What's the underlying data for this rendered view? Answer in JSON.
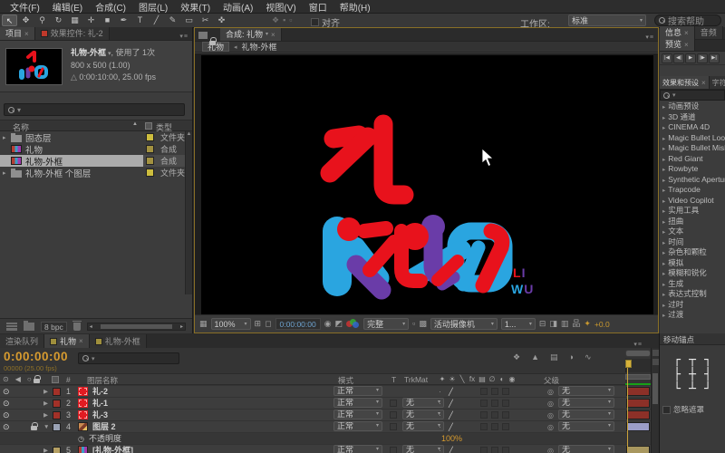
{
  "menu_bar": {
    "items": [
      "文件(F)",
      "编辑(E)",
      "合成(C)",
      "图层(L)",
      "效果(T)",
      "动画(A)",
      "视图(V)",
      "窗口",
      "帮助(H)"
    ]
  },
  "toolbar": {
    "tools": [
      {
        "name": "selection-tool",
        "glyph": "↖",
        "active": true
      },
      {
        "name": "hand-tool",
        "glyph": "✥"
      },
      {
        "name": "zoom-tool",
        "glyph": "⚲"
      },
      {
        "name": "rotation-tool",
        "glyph": "↻"
      },
      {
        "name": "camera-tool",
        "glyph": "▦"
      },
      {
        "name": "pan-behind-tool",
        "glyph": "✛"
      },
      {
        "name": "shape-tool",
        "glyph": "■"
      },
      {
        "name": "pen-tool",
        "glyph": "✒"
      },
      {
        "name": "text-tool",
        "glyph": "T"
      },
      {
        "name": "brush-tool",
        "glyph": "╱"
      },
      {
        "name": "clone-stamp-tool",
        "glyph": "✎"
      },
      {
        "name": "eraser-tool",
        "glyph": "▭"
      },
      {
        "name": "roto-brush-tool",
        "glyph": "✂"
      },
      {
        "name": "puppet-pin-tool",
        "glyph": "✜"
      }
    ],
    "extra_icons": [
      {
        "name": "disabled-tool-icon-1",
        "glyph": "❖"
      },
      {
        "name": "disabled-tool-icon-2",
        "glyph": "▪"
      },
      {
        "name": "disabled-tool-icon-3",
        "glyph": "▫"
      }
    ],
    "align_label": "对齐",
    "workspace_label": "工作区:",
    "workspace_value": "标准",
    "search_placeholder": "搜索帮助"
  },
  "project_panel": {
    "tab_project": "项目",
    "tab_effect_controls": "效果控件: 礼-2",
    "info_name": "礼物-外框",
    "info_usage": ", 使用了 1次",
    "info_size": "800 x 500 (1.00)",
    "info_duration": "0:00:10:00, 25.00 fps",
    "col_name": "名称",
    "col_type": "类型",
    "items": [
      {
        "name": "固态层",
        "type": "文件夹",
        "icon": "folder",
        "arrow": "▸",
        "chip": "#cdbd3e"
      },
      {
        "name": "礼物",
        "type": "合成",
        "icon": "comp",
        "arrow": "",
        "chip": "#a39240"
      },
      {
        "name": "礼物-外框",
        "type": "合成",
        "icon": "comp",
        "arrow": "",
        "chip": "#a39240",
        "selected": true
      },
      {
        "name": "礼物-外框 个图层",
        "type": "文件夹",
        "icon": "folder",
        "arrow": "▸",
        "chip": "#cdbd3e"
      }
    ],
    "bpc": "8 bpc"
  },
  "viewer": {
    "tab_label": "合成: 礼物",
    "crumb_current": "礼物",
    "crumb_parent": "礼物-外框",
    "zoom": "100%",
    "time": "0:00:00:00",
    "resolution": "完整",
    "camera": "活动摄像机",
    "views": "1...",
    "exposure": "+0.0",
    "icons": {
      "ratio": "▦",
      "grid": "⊞",
      "roi": "◻",
      "snapshot": "◉",
      "show_snapshot": "◩",
      "region": "▫",
      "transparency": "▩",
      "pixel_aspect": "⊟",
      "fast_preview": "◨",
      "timeline_btn": "▥",
      "flowchart": "品",
      "exposure_icon": "✦"
    },
    "logo": {
      "l1": "L",
      "l2": "I",
      "l3": "W",
      "l4": "U"
    },
    "logo_colors": {
      "red": "#e8121c",
      "cyan": "#2aa5e0",
      "purple": "#6a3ca8"
    }
  },
  "right_panel": {
    "tab_info": "信息",
    "tab_audio": "音频",
    "tab_preview": "预览",
    "transport": [
      {
        "name": "first-frame-button",
        "glyph": "|◀"
      },
      {
        "name": "previous-frame-button",
        "glyph": "◀|"
      },
      {
        "name": "play-button",
        "glyph": "▶"
      },
      {
        "name": "next-frame-button",
        "glyph": "|▶"
      },
      {
        "name": "last-frame-button",
        "glyph": "▶|"
      }
    ],
    "tab_effects": "效果和预设",
    "tab_character": "字符",
    "categories": [
      "动画预设",
      "3D 通道",
      "CINEMA 4D",
      "Magic Bullet Looks",
      "Magic Bullet MisFire",
      "Red Giant",
      "Rowbyte",
      "Synthetic Aperture",
      "Trapcode",
      "Video Copilot",
      "实用工具",
      "扭曲",
      "文本",
      "时间",
      "杂色和颗粒",
      "模拟",
      "模糊和锐化",
      "生成",
      "表达式控制",
      "过时",
      "过渡"
    ]
  },
  "timeline": {
    "tab_render_queue": "渲染队列",
    "tab_comp1": "礼物",
    "tab_comp2": "礼物-外框",
    "time": "0:00:00:00",
    "frame_info": "00000 (25.00 fps)",
    "col_layer_name": "图层名称",
    "col_mode": "模式",
    "col_t": "T",
    "col_trkmat": "TrkMat",
    "col_parent": "父级",
    "header_icons": [
      {
        "name": "eye-column-icon",
        "glyph": "⊙"
      },
      {
        "name": "audio-column-icon",
        "glyph": "◀"
      },
      {
        "name": "solo-column-icon",
        "glyph": "○"
      }
    ],
    "mini_icons": [
      {
        "name": "live-update-icon",
        "glyph": "❖"
      },
      {
        "name": "draft-3d-icon",
        "glyph": "▲"
      },
      {
        "name": "frame-blending-icon",
        "glyph": "▤"
      },
      {
        "name": "motion-blur-icon",
        "glyph": "◑"
      },
      {
        "name": "graph-editor-icon",
        "glyph": "∿"
      }
    ],
    "switch_icons": [
      {
        "name": "shy-icon",
        "glyph": "✦"
      },
      {
        "name": "collapse-icon",
        "glyph": "☀"
      },
      {
        "name": "quality-icon",
        "glyph": "╲"
      },
      {
        "name": "effects-icon",
        "glyph": "fx"
      },
      {
        "name": "frame-blend-icon",
        "glyph": "▤"
      },
      {
        "name": "motion-blur-col-icon",
        "glyph": "∅"
      },
      {
        "name": "adjustment-icon",
        "glyph": "◐"
      },
      {
        "name": "3d-layer-icon",
        "glyph": "◉"
      }
    ],
    "rows": [
      {
        "isLayer": true,
        "visible": true,
        "arrow": "▶",
        "chip": "#a33128",
        "num": "1",
        "icon": "solid-red",
        "name": "礼-2",
        "mode": "正常",
        "trkmat": "",
        "parent": "无",
        "bar": "#8c3028"
      },
      {
        "isLayer": true,
        "visible": true,
        "arrow": "▶",
        "chip": "#a33128",
        "num": "2",
        "icon": "solid-red",
        "name": "礼-1",
        "mode": "正常",
        "trkmat": "无",
        "parent": "无",
        "bar": "#8c3028"
      },
      {
        "isLayer": true,
        "visible": true,
        "arrow": "▶",
        "chip": "#a33128",
        "num": "3",
        "icon": "solid-red",
        "name": "礼-3",
        "mode": "正常",
        "trkmat": "无",
        "parent": "无",
        "bar": "#8c3028"
      },
      {
        "isLayer": true,
        "visible": true,
        "locked": true,
        "arrow": "▼",
        "chip": "#9aa2b5",
        "num": "4",
        "icon": "image",
        "name": "图层 2",
        "mode": "正常",
        "trkmat": "无",
        "parent": "无",
        "bar": "#9b9dc8"
      },
      {
        "isProp": true,
        "pname": "不透明度",
        "pvalue": "100%"
      },
      {
        "isLayer": true,
        "visible": false,
        "arrow": "▶",
        "chip": "#b49f63",
        "num": "5",
        "icon": "comp",
        "name": "[礼物-外框]",
        "mode": "正常",
        "trkmat": "无",
        "parent": "无",
        "bar": "#a8975f"
      }
    ]
  },
  "anchor_panel": {
    "title": "移动锚点",
    "grid": [
      "┌",
      "┬",
      "┐",
      "├",
      "┼",
      "┤",
      "└",
      "┴",
      "┘"
    ],
    "checkbox_label": "忽略遮罩"
  }
}
